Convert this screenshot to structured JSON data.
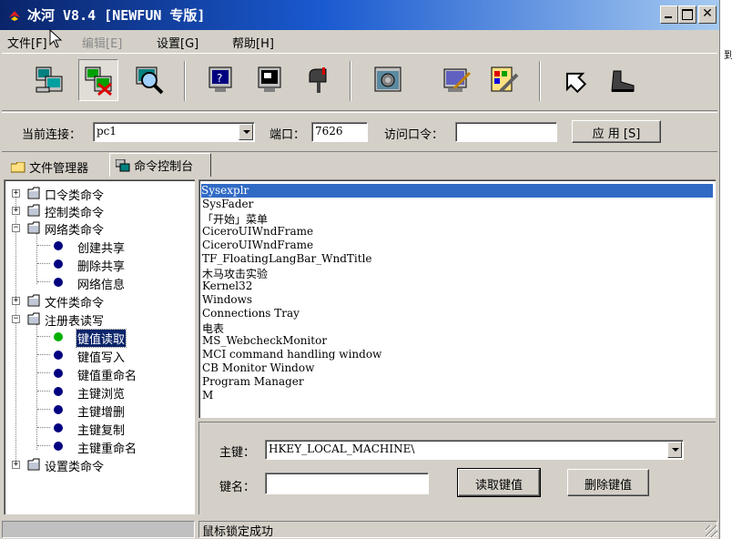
{
  "window": {
    "title": "冰河 V8.4 [NEWFUN 专版]"
  },
  "menu": {
    "file": "文件[F]",
    "edit": "编辑[E]",
    "settings": "设置[G]",
    "help": "帮助[H]"
  },
  "toolbar": {
    "icons": [
      "auto-connect-icon",
      "disconnect-icon",
      "search-host-icon",
      "screen-capture-icon",
      "screen-control-icon",
      "rename-host-icon",
      "settings-icon",
      "server-config-icon",
      "tools-icon",
      "upload-icon",
      "exit-icon"
    ]
  },
  "connection": {
    "label": "当前连接：",
    "host_value": "pc1",
    "port_label": "端口：",
    "port_value": "7626",
    "password_label": "访问口令：",
    "password_value": "",
    "apply_label": "应 用 [S]"
  },
  "tabs": {
    "file_manager": "文件管理器",
    "command_console": "命令控制台"
  },
  "tree": {
    "items": [
      {
        "label": "口令类命令"
      },
      {
        "label": "控制类命令"
      },
      {
        "label": "网络类命令"
      },
      {
        "label": "创建共享"
      },
      {
        "label": "删除共享"
      },
      {
        "label": "网络信息"
      },
      {
        "label": "文件类命令"
      },
      {
        "label": "注册表读写"
      },
      {
        "label": "键值读取"
      },
      {
        "label": "键值写入"
      },
      {
        "label": "键值重命名"
      },
      {
        "label": "主键浏览"
      },
      {
        "label": "主键增删"
      },
      {
        "label": "主键复制"
      },
      {
        "label": "主键重命名"
      },
      {
        "label": "设置类命令"
      }
    ]
  },
  "window_list": {
    "items": [
      "Sysexplr",
      "SysFader",
      "「开始」菜单",
      "CiceroUIWndFrame",
      "CiceroUIWndFrame",
      "TF_FloatingLangBar_WndTitle",
      "木马攻击实验",
      "Kernel32",
      "Windows",
      "Connections Tray",
      "电表",
      "MS_WebcheckMonitor",
      "MCI command handling window",
      "CB Monitor Window",
      "Program Manager",
      "M"
    ]
  },
  "registry": {
    "main_key_label": "主键：",
    "main_key_value": "HKEY_LOCAL_MACHINE\\",
    "key_name_label": "键名：",
    "key_name_value": "",
    "read_button": "读取键值",
    "delete_button": "删除键值"
  },
  "status": {
    "message": "鼠标锁定成功"
  },
  "right_window": {
    "text": "到"
  },
  "colors": {
    "title_start": "#0a246a",
    "title_end": "#a6caf0",
    "selection": "#316ac5",
    "face": "#d4d0c8"
  }
}
